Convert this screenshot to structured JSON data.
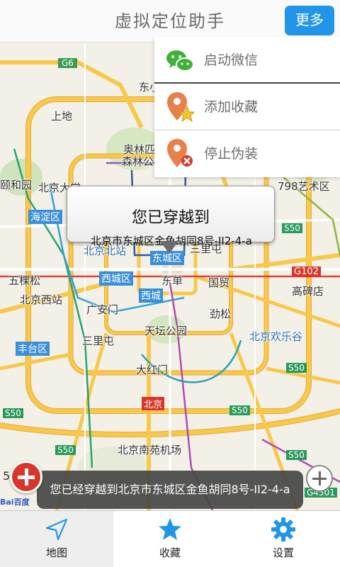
{
  "header": {
    "title": "虚拟定位助手",
    "more_label": "更多"
  },
  "menu": {
    "items": [
      {
        "label": "启动微信",
        "icon": "wechat-icon"
      },
      {
        "label": "添加收藏",
        "icon": "pin-star-icon"
      },
      {
        "label": "停止伪装",
        "icon": "pin-close-icon"
      }
    ]
  },
  "callout": {
    "title": "您已穿越到",
    "address": "北京市东城区金鱼胡同8号-II2-4-a"
  },
  "toast": {
    "message": "您已经穿越到北京市东城区金鱼胡同8号-II2-4-a"
  },
  "map": {
    "zoom_level": "5",
    "labels": {
      "g6": "G6",
      "dongxiao": "东小",
      "shangdi": "上地",
      "aolinpi": "奥林匹",
      "senlingong": "森林公",
      "yiheyuan": "颐和园",
      "beijingda": "北京大学",
      "haidianqu": "海淀区",
      "yiheyuan2": "798艺术区",
      "s50a": "S50",
      "beijingbeizhan": "北京北站",
      "dongcheng": "东城区",
      "sanlitun": "三里屯",
      "wukesong": "五棵松",
      "xichengqu": "西城区",
      "dongdan": "东单",
      "guomao": "国贸",
      "g102": "G102",
      "gaobeidian": "高碑店",
      "beijingxizhan": "北京西站",
      "xidan": "西城",
      "guanganmen": "广安门",
      "jinsong": "劲松",
      "tiantan": "天坛公园",
      "beijinghuanle": "北京欢乐谷",
      "fengtaiqu": "丰台区",
      "sanlihe": "三里屯",
      "dahongmen": "大红门",
      "s50b": "S50",
      "s50c": "S50",
      "s50d": "S50",
      "s50e": "S50",
      "beijing": "北京",
      "nanyuan": "北京南苑机场",
      "s50f": "S50",
      "g4501": "G4501",
      "baidu": "Bai百度"
    }
  },
  "tabs": [
    {
      "label": "地图",
      "icon": "navigation-arrow-icon"
    },
    {
      "label": "收藏",
      "icon": "star-icon"
    },
    {
      "label": "设置",
      "icon": "gear-icon"
    }
  ],
  "colors": {
    "accent": "#2196e8",
    "road_major": "#f7c84a",
    "road_outline": "#e0a93a",
    "fab_red": "#d9362b",
    "wechat_green": "#3fb235",
    "pin_orange": "#e8804a"
  }
}
